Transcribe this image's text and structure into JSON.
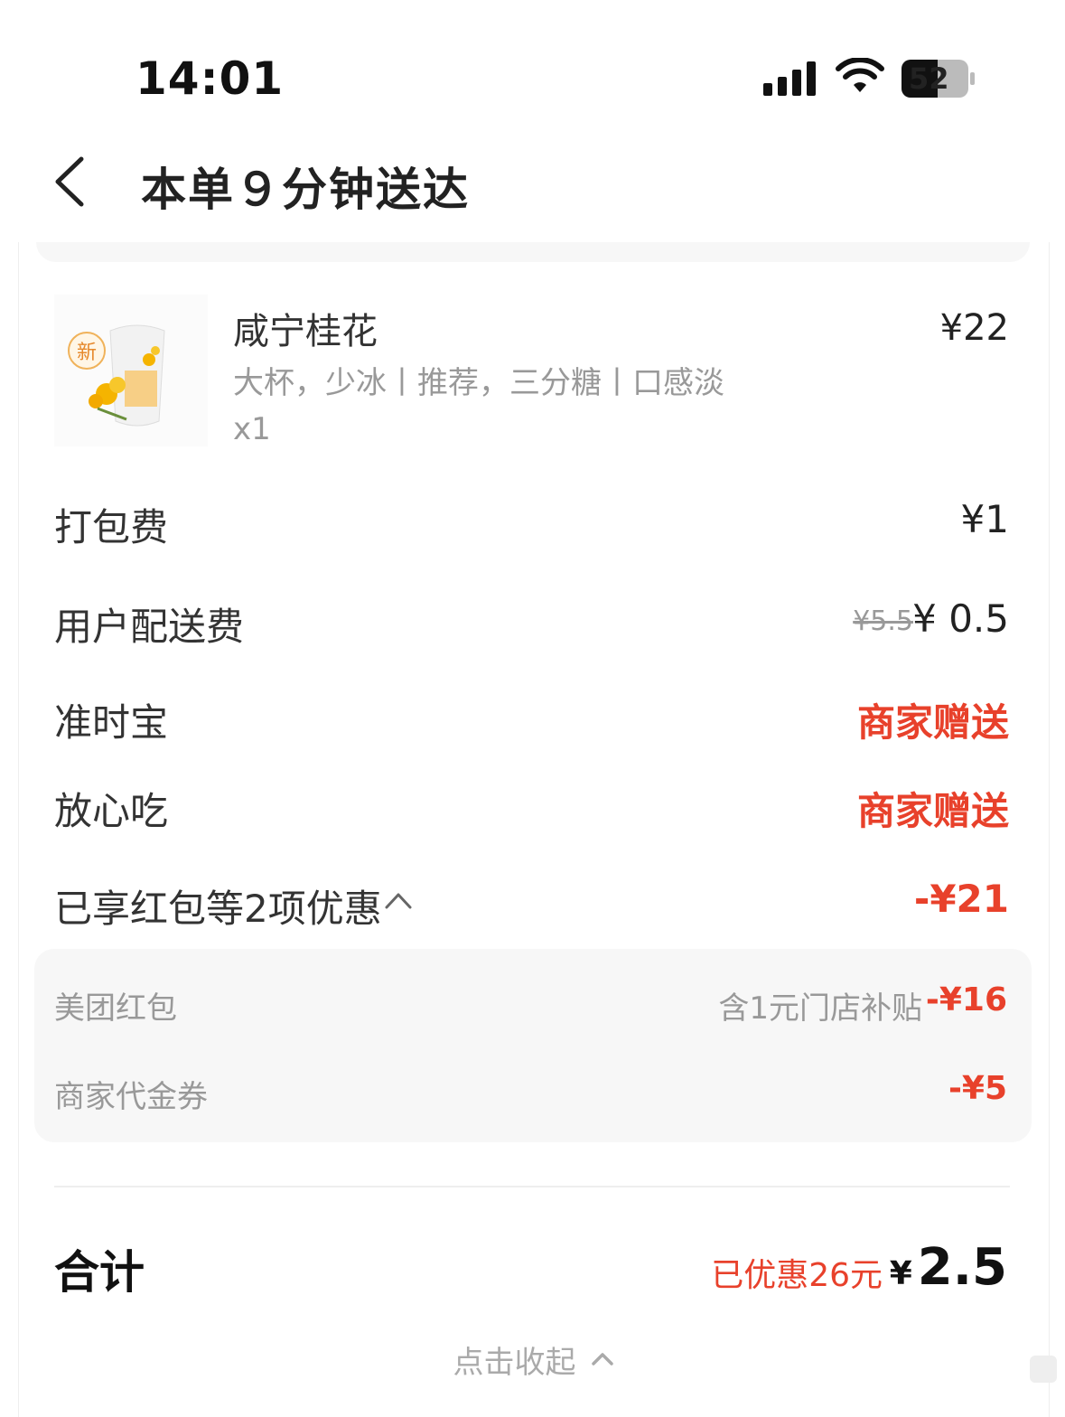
{
  "status_bar": {
    "time": "14:01",
    "battery": "52",
    "icons": [
      "signal-icon",
      "wifi-icon",
      "battery-icon"
    ]
  },
  "header": {
    "back_icon": "chevron-left-icon",
    "title": "本单９分钟送达"
  },
  "product": {
    "name": "咸宁桂花",
    "spec": "大杯，少冰丨推荐，三分糖丨口感淡",
    "qty": "x1",
    "price": "¥22",
    "thumb_badge": "新"
  },
  "fees": {
    "packing_label": "打包费",
    "packing_value": "¥1",
    "delivery_label": "用户配送费",
    "delivery_original": "¥5.5",
    "delivery_value": "¥ 0.5",
    "ontime_label": "准时宝",
    "ontime_value": "商家赠送",
    "safe_label": "放心吃",
    "safe_value": "商家赠送"
  },
  "promotions": {
    "summary_label": "已享红包等2项优惠",
    "summary_value": "-¥21",
    "items": [
      {
        "label": "美团红包",
        "note": "含1元门店补贴",
        "value": "-¥16"
      },
      {
        "label": "商家代金券",
        "note": "",
        "value": "-¥5"
      }
    ]
  },
  "total": {
    "label": "合计",
    "saved": "已优惠26元",
    "currency": "¥",
    "amount": "2.5"
  },
  "footer": {
    "collapse_label": "点击收起"
  },
  "colors": {
    "accent_red": "#e8412b",
    "muted": "#999999"
  }
}
